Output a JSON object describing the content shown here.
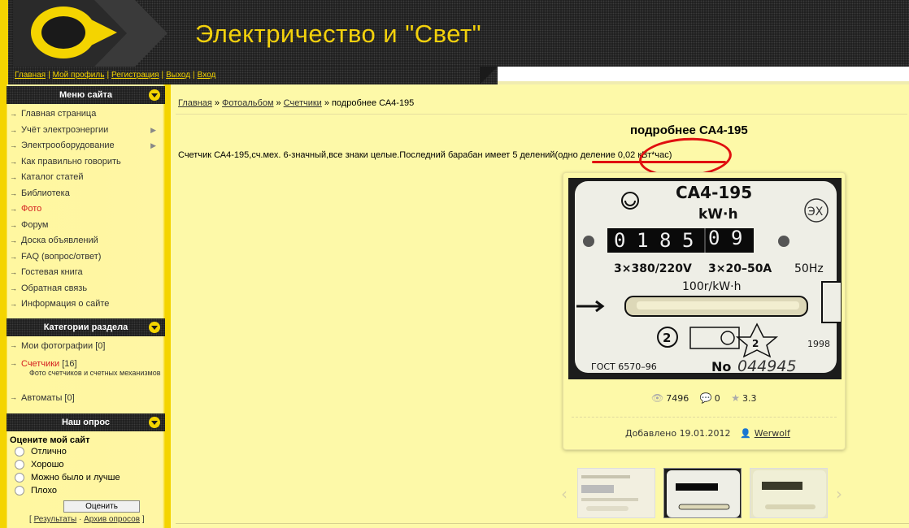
{
  "header": {
    "site_title": "Электричество и \"Свет\"",
    "nav": [
      {
        "label": "Главная"
      },
      {
        "label": "Мой профиль"
      },
      {
        "label": "Регистрация"
      },
      {
        "label": "Выход"
      },
      {
        "label": "Вход"
      }
    ]
  },
  "sidebar": {
    "menu_title": "Меню сайта",
    "menu_items": [
      {
        "label": "Главная страница"
      },
      {
        "label": "Учёт электроэнергии"
      },
      {
        "label": "Электрооборудование"
      },
      {
        "label": "Как правильно говорить"
      },
      {
        "label": "Каталог статей"
      },
      {
        "label": "Библиотека"
      },
      {
        "label": "Фото"
      },
      {
        "label": "Форум"
      },
      {
        "label": "Доска объявлений"
      },
      {
        "label": "FAQ (вопрос/ответ)"
      },
      {
        "label": "Гостевая книга"
      },
      {
        "label": "Обратная связь"
      },
      {
        "label": "Информация о сайте"
      }
    ],
    "categories_title": "Категории раздела",
    "categories": [
      {
        "name": "Мои фотографии",
        "count": "[0]",
        "desc": ""
      },
      {
        "name": "Счетчики",
        "count": "[16]",
        "desc": "Фото счетчиков и счетных механизмов"
      },
      {
        "name": "Автоматы",
        "count": "[0]",
        "desc": ""
      }
    ],
    "poll_title": "Наш опрос",
    "poll": {
      "question": "Оцените мой сайт",
      "options": [
        "Отлично",
        "Хорошо",
        "Можно было и лучше",
        "Плохо"
      ],
      "submit": "Оценить",
      "results_link": "Результаты",
      "archive_link": "Архив опросов",
      "bracket_open": "[",
      "bracket_close": "]",
      "dot": "·"
    }
  },
  "breadcrumb": {
    "items": [
      "Главная",
      "Фотоальбом",
      "Счетчики"
    ],
    "current": "подробнее СА4-195",
    "sep": "»"
  },
  "photo": {
    "title": "подробнее СА4-195",
    "description": "Счетчик СА4-195,сч.мех. 6-значный,все знаки целые.Последний барабан имеет 5 делений(одно деление 0,02 кВт*час)",
    "meter": {
      "model": "СА4-195",
      "unit": "kW·h",
      "digits": [
        "0",
        "1",
        "8",
        "5",
        "0",
        "9"
      ],
      "spec_left": "3×380/220V",
      "spec_mid": "3×20–50A",
      "spec_right": "50Hz",
      "rpm": "100r/kW·h",
      "gost": "ГОСТ  6570–96",
      "no_label": "No",
      "serial": "044945",
      "year": "1998",
      "class_mark": "2",
      "logo_text": "ЭX"
    },
    "stats": {
      "views": "7496",
      "comments": "0",
      "rating": "3.3"
    },
    "added_label": "Добавлено",
    "added_date": "19.01.2012",
    "author": "Werwolf"
  },
  "colors": {
    "accent_yellow": "#f4d400",
    "banner_dark": "#1a1a1a",
    "page_bg": "#fdf9a8",
    "annotation_red": "#e01010",
    "active_link": "#d42020"
  },
  "icons": {
    "views": "eye-icon",
    "comments": "comment-icon",
    "rating": "star-icon",
    "author": "user-icon"
  }
}
